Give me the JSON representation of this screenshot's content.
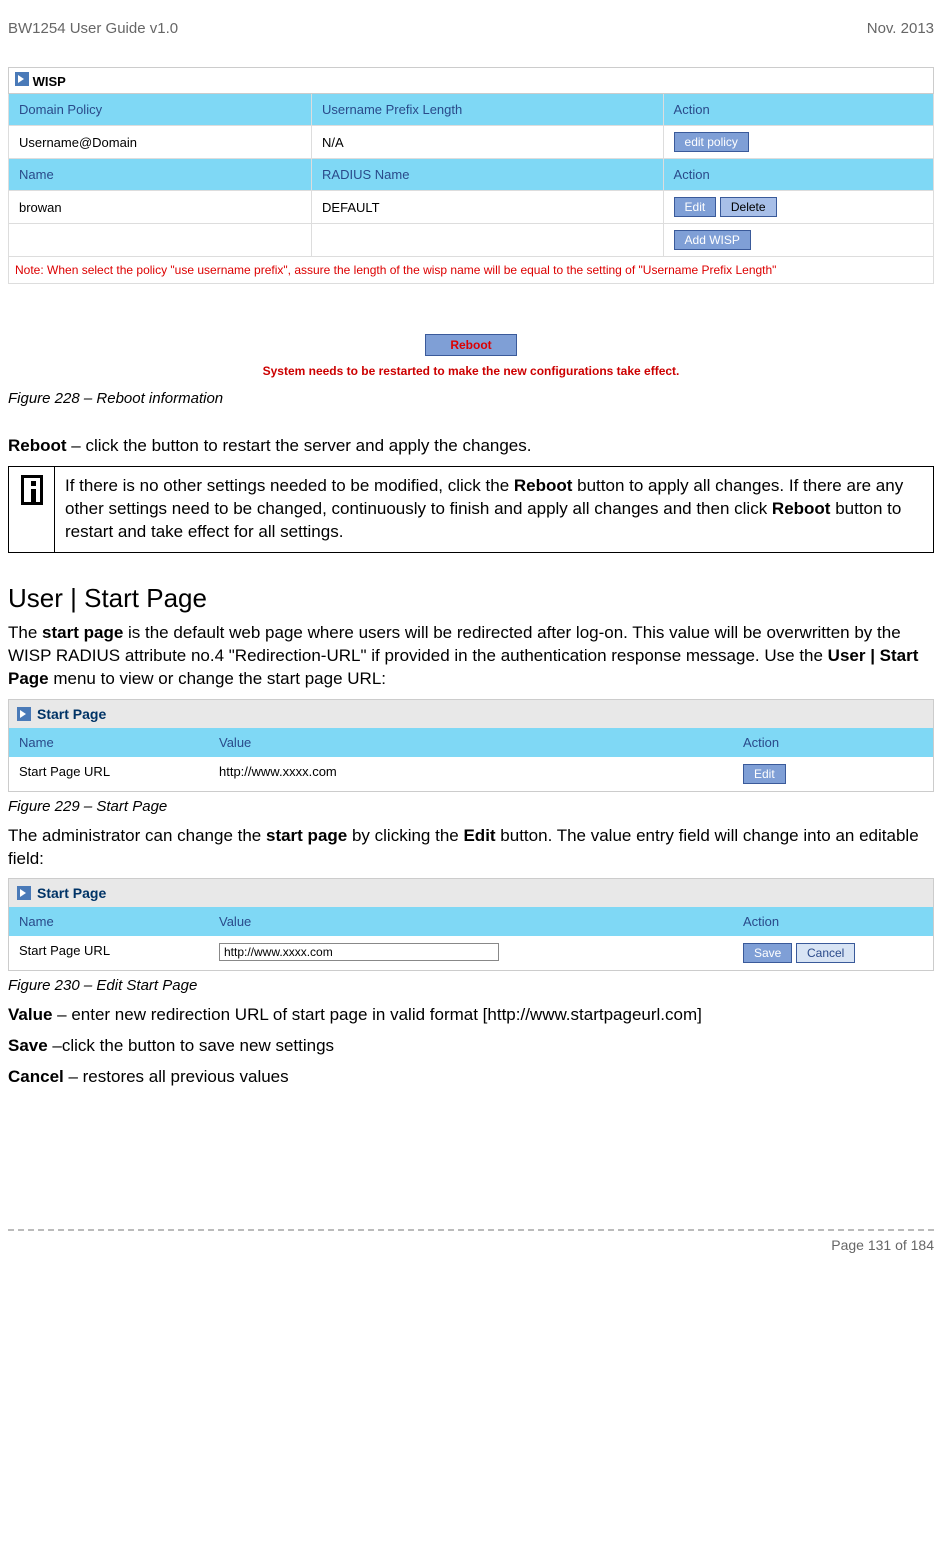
{
  "header": {
    "left": "BW1254 User Guide v1.0",
    "right": "Nov.  2013"
  },
  "wisp": {
    "title": "WISP",
    "headers1": {
      "c1": "Domain Policy",
      "c2": "Username Prefix Length",
      "c3": "Action"
    },
    "row1": {
      "c1": "Username@Domain",
      "c2": "N/A",
      "btn": "edit  policy"
    },
    "headers2": {
      "c1": "Name",
      "c2": "RADIUS Name",
      "c3": "Action"
    },
    "row2": {
      "c1": "browan",
      "c2": "DEFAULT",
      "btn_edit": "Edit",
      "btn_delete": "Delete"
    },
    "add_btn": "Add WISP",
    "note": "Note: When select the policy \"use username prefix\", assure the length of the wisp name will be equal to the setting of \"Username Prefix Length\""
  },
  "reboot": {
    "btn": "Reboot",
    "msg": "System needs to be restarted to make the new configurations take effect."
  },
  "fig228": "Figure 228 – Reboot information",
  "reboot_text": {
    "label": "Reboot",
    "rest": " – click the button to restart the server and apply the changes."
  },
  "infobox": {
    "p1a": "If there is no other settings needed to be modified, click the ",
    "p1b": "Reboot",
    "p1c": " button to apply all changes. If there are any other settings need to be changed, continuously to finish and apply all changes and then click ",
    "p1d": "Reboot",
    "p1e": " button to restart and take effect  for all settings."
  },
  "section": {
    "title": "User | Start Page"
  },
  "intro": {
    "a": "The ",
    "b": "start page",
    "c": " is the default web page where users will be redirected after log-on. This value will be overwritten by the WISP RADIUS attribute no.4 \"Redirection-URL\" if provided in the authentication response message. Use the ",
    "d": "User | Start Page",
    "e": " menu to view or change the start page URL:"
  },
  "sp1": {
    "title": "Start Page",
    "hdr": {
      "name": "Name",
      "value": "Value",
      "action": "Action"
    },
    "row": {
      "name": "Start Page URL",
      "value": "http://www.xxxx.com",
      "btn": "Edit"
    }
  },
  "fig229": "Figure 229 – Start Page",
  "admin_text": {
    "a": "The administrator can change the ",
    "b": "start page",
    "c": " by clicking the ",
    "d": "Edit",
    "e": " button. The value entry field will change into an editable field:"
  },
  "sp2": {
    "title": "Start Page",
    "hdr": {
      "name": "Name",
      "value": "Value",
      "action": "Action"
    },
    "row": {
      "name": "Start Page URL",
      "value": "http://www.xxxx.com",
      "btn_save": "Save",
      "btn_cancel": "Cancel"
    }
  },
  "fig230": "Figure 230 – Edit Start Page",
  "val_text": {
    "a": "Value",
    "b": " – enter new redirection URL of start page in valid format [http://www.startpageurl.com]"
  },
  "save_text": {
    "a": "Save",
    "b": " –click the button to save new settings"
  },
  "cancel_text": {
    "a": "Cancel",
    "b": " – restores all previous values"
  },
  "footer": "Page 131 of 184"
}
